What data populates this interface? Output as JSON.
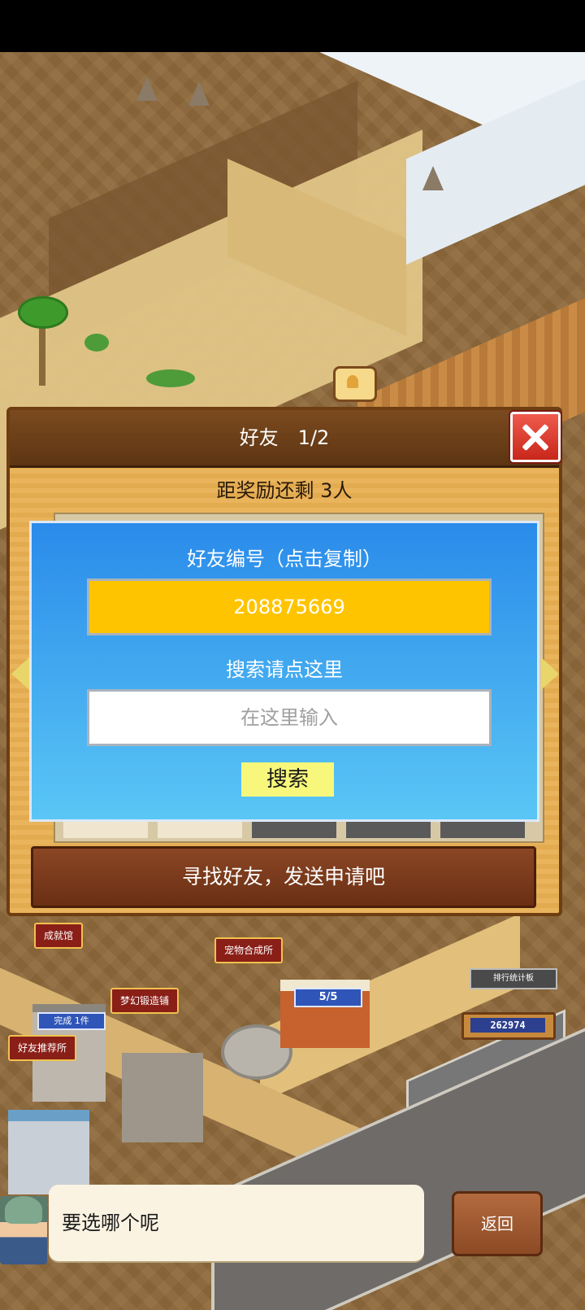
{
  "panel": {
    "title": "好友　1/2",
    "reward_text": "距奖励还剩 3人",
    "close_icon": "close-x-icon",
    "send_button": "寻找好友，发送申请吧"
  },
  "friend_dialog": {
    "id_label": "好友编号（点击复制）",
    "friend_id": "208875669",
    "search_label": "搜索请点这里",
    "search_placeholder": "在这里输入",
    "search_button": "搜索"
  },
  "map": {
    "labels": {
      "achievement_hall": "成就馆",
      "pet_synthesis": "宠物合成所",
      "dream_forge": "梦幻锻造铺",
      "friend_recommend": "好友推荐所",
      "ranking_sign": "排行统计板"
    },
    "complete_badge": "完成 1件",
    "capacity_badge": "5/5",
    "score": "262974"
  },
  "bottom": {
    "dialog_text": "要选哪个呢",
    "back_button": "返回"
  },
  "colors": {
    "panel_wood": "#e9b45b",
    "header_brown": "#6b3d17",
    "dialog_blue": "#2a8bea",
    "id_yellow": "#ffc400",
    "search_button": "#f6f77b",
    "close_red": "#e0392c"
  }
}
